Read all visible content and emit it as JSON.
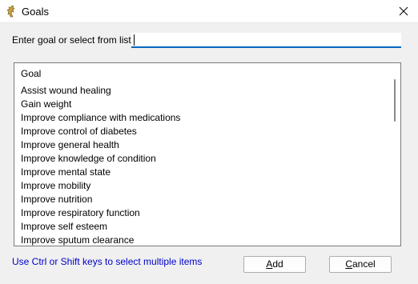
{
  "window": {
    "title": "Goals",
    "icon": "yellow-figure-icon",
    "close_icon": "close-icon"
  },
  "form": {
    "prompt_label": "Enter goal or select from list:",
    "input_value": "",
    "input_placeholder": ""
  },
  "list": {
    "header": "Goal",
    "items": [
      "Assist wound healing",
      "Gain weight",
      "Improve compliance with medications",
      "Improve control of diabetes",
      "Improve general health",
      "Improve knowledge of condition",
      "Improve mental state",
      "Improve mobility",
      "Improve nutrition",
      "Improve respiratory function",
      "Improve self esteem",
      "Improve sputum clearance"
    ]
  },
  "footer": {
    "hint": "Use Ctrl or Shift keys to select multiple items",
    "add_label": {
      "first": "A",
      "rest": "dd"
    },
    "cancel_label": {
      "first": "C",
      "rest": "ancel"
    }
  },
  "colors": {
    "accent": "#0067c0",
    "hint_text": "#0000cc",
    "icon": "#c8a23a"
  }
}
